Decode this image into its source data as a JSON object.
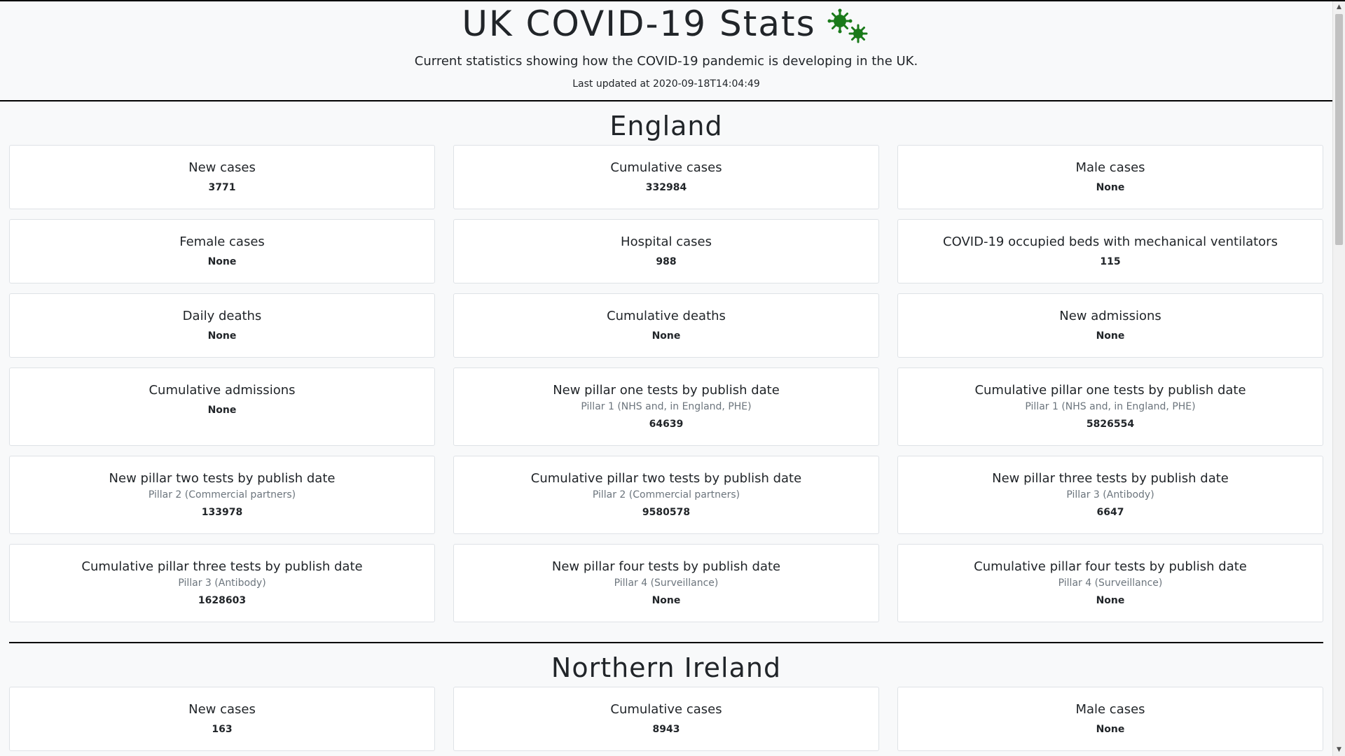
{
  "header": {
    "title": "UK COVID-19 Stats",
    "subtitle": "Current statistics showing how the COVID-19 pandemic is developing in the UK.",
    "last_updated": "Last updated at 2020-09-18T14:04:49",
    "icon": "virus-icon",
    "icon_color": "#1a7a1a"
  },
  "regions": [
    {
      "name": "England",
      "cards": [
        {
          "title": "New cases",
          "sub": "",
          "value": "3771"
        },
        {
          "title": "Cumulative cases",
          "sub": "",
          "value": "332984"
        },
        {
          "title": "Male cases",
          "sub": "",
          "value": "None"
        },
        {
          "title": "Female cases",
          "sub": "",
          "value": "None"
        },
        {
          "title": "Hospital cases",
          "sub": "",
          "value": "988"
        },
        {
          "title": "COVID-19 occupied beds with mechanical ventilators",
          "sub": "",
          "value": "115"
        },
        {
          "title": "Daily deaths",
          "sub": "",
          "value": "None"
        },
        {
          "title": "Cumulative deaths",
          "sub": "",
          "value": "None"
        },
        {
          "title": "New admissions",
          "sub": "",
          "value": "None"
        },
        {
          "title": "Cumulative admissions",
          "sub": "",
          "value": "None"
        },
        {
          "title": "New pillar one tests by publish date",
          "sub": "Pillar 1 (NHS and, in England, PHE)",
          "value": "64639"
        },
        {
          "title": "Cumulative pillar one tests by publish date",
          "sub": "Pillar 1 (NHS and, in England, PHE)",
          "value": "5826554"
        },
        {
          "title": "New pillar two tests by publish date",
          "sub": "Pillar 2 (Commercial partners)",
          "value": "133978"
        },
        {
          "title": "Cumulative pillar two tests by publish date",
          "sub": "Pillar 2 (Commercial partners)",
          "value": "9580578"
        },
        {
          "title": "New pillar three tests by publish date",
          "sub": "Pillar 3 (Antibody)",
          "value": "6647"
        },
        {
          "title": "Cumulative pillar three tests by publish date",
          "sub": "Pillar 3 (Antibody)",
          "value": "1628603"
        },
        {
          "title": "New pillar four tests by publish date",
          "sub": "Pillar 4 (Surveillance)",
          "value": "None"
        },
        {
          "title": "Cumulative pillar four tests by publish date",
          "sub": "Pillar 4 (Surveillance)",
          "value": "None"
        }
      ]
    },
    {
      "name": "Northern Ireland",
      "cards": [
        {
          "title": "New cases",
          "sub": "",
          "value": "163"
        },
        {
          "title": "Cumulative cases",
          "sub": "",
          "value": "8943"
        },
        {
          "title": "Male cases",
          "sub": "",
          "value": "None"
        }
      ]
    }
  ]
}
